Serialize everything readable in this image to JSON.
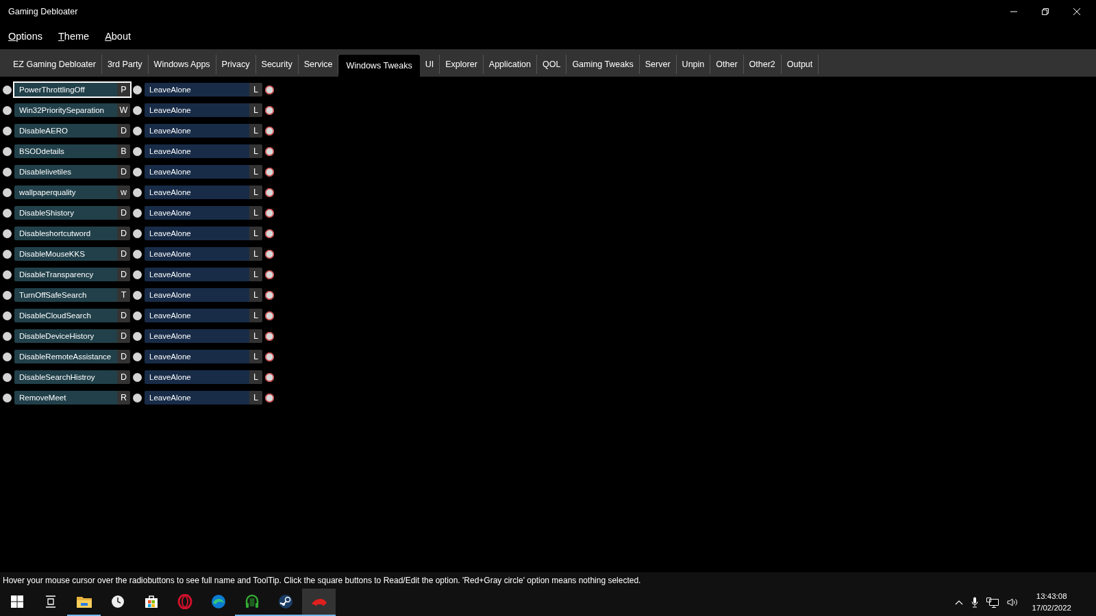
{
  "window": {
    "title": "Gaming Debloater"
  },
  "menu": [
    "Options",
    "Theme",
    "About"
  ],
  "tabs": [
    {
      "label": "EZ Gaming Debloater",
      "selected": false
    },
    {
      "label": "3rd Party",
      "selected": false
    },
    {
      "label": "Windows Apps",
      "selected": false
    },
    {
      "label": "Privacy",
      "selected": false
    },
    {
      "label": "Security",
      "selected": false
    },
    {
      "label": "Service",
      "selected": false
    },
    {
      "label": "Windows Tweaks",
      "selected": true
    },
    {
      "label": "UI",
      "selected": false
    },
    {
      "label": "Explorer",
      "selected": false
    },
    {
      "label": "Application",
      "selected": false
    },
    {
      "label": "QOL",
      "selected": false
    },
    {
      "label": "Gaming Tweaks",
      "selected": false
    },
    {
      "label": "Server",
      "selected": false
    },
    {
      "label": "Unpin",
      "selected": false
    },
    {
      "label": "Other",
      "selected": false
    },
    {
      "label": "Other2",
      "selected": false
    },
    {
      "label": "Output",
      "selected": false
    }
  ],
  "rows": [
    {
      "name": "PowerThrottlingOff",
      "key": "P",
      "value": "LeaveAlone",
      "value_key": "L",
      "focused": true,
      "radios": [
        {
          "selected": false
        },
        {
          "selected": false
        },
        {
          "selected": false
        }
      ]
    },
    {
      "name": "Win32PrioritySeparation",
      "key": "W",
      "value": "LeaveAlone",
      "value_key": "L",
      "focused": false,
      "radios": [
        {
          "selected": false
        },
        {
          "selected": false
        },
        {
          "selected": false
        }
      ]
    },
    {
      "name": "DisableAERO",
      "key": "D",
      "value": "LeaveAlone",
      "value_key": "L",
      "focused": false,
      "radios": [
        {
          "selected": false
        },
        {
          "selected": false
        },
        {
          "selected": false
        }
      ]
    },
    {
      "name": "BSODdetails",
      "key": "B",
      "value": "LeaveAlone",
      "value_key": "L",
      "focused": false,
      "radios": [
        {
          "selected": false
        },
        {
          "selected": false
        },
        {
          "selected": false
        }
      ]
    },
    {
      "name": "Disablelivetiles",
      "key": "D",
      "value": "LeaveAlone",
      "value_key": "L",
      "focused": false,
      "radios": [
        {
          "selected": false
        },
        {
          "selected": false
        },
        {
          "selected": false
        }
      ]
    },
    {
      "name": "wallpaperquality",
      "key": "w",
      "value": "LeaveAlone",
      "value_key": "L",
      "focused": false,
      "radios": [
        {
          "selected": false
        },
        {
          "selected": false
        },
        {
          "selected": false
        }
      ]
    },
    {
      "name": "DisableShistory",
      "key": "D",
      "value": "LeaveAlone",
      "value_key": "L",
      "focused": false,
      "radios": [
        {
          "selected": false
        },
        {
          "selected": false
        },
        {
          "selected": false
        }
      ]
    },
    {
      "name": "Disableshortcutword",
      "key": "D",
      "value": "LeaveAlone",
      "value_key": "L",
      "focused": false,
      "radios": [
        {
          "selected": false
        },
        {
          "selected": false
        },
        {
          "selected": false
        }
      ]
    },
    {
      "name": "DisableMouseKKS",
      "key": "D",
      "value": "LeaveAlone",
      "value_key": "L",
      "focused": false,
      "radios": [
        {
          "selected": false
        },
        {
          "selected": false
        },
        {
          "selected": false
        }
      ]
    },
    {
      "name": "DisableTransparency",
      "key": "D",
      "value": "LeaveAlone",
      "value_key": "L",
      "focused": false,
      "radios": [
        {
          "selected": false
        },
        {
          "selected": false
        },
        {
          "selected": false
        }
      ]
    },
    {
      "name": "TurnOffSafeSearch",
      "key": "T",
      "value": "LeaveAlone",
      "value_key": "L",
      "focused": false,
      "radios": [
        {
          "selected": false
        },
        {
          "selected": false
        },
        {
          "selected": false
        }
      ]
    },
    {
      "name": "DisableCloudSearch",
      "key": "D",
      "value": "LeaveAlone",
      "value_key": "L",
      "focused": false,
      "radios": [
        {
          "selected": false
        },
        {
          "selected": false
        },
        {
          "selected": false
        }
      ]
    },
    {
      "name": "DisableDeviceHistory",
      "key": "D",
      "value": "LeaveAlone",
      "value_key": "L",
      "focused": false,
      "radios": [
        {
          "selected": false
        },
        {
          "selected": false
        },
        {
          "selected": false
        }
      ]
    },
    {
      "name": "DisableRemoteAssistance",
      "key": "D",
      "value": "LeaveAlone",
      "value_key": "L",
      "focused": false,
      "radios": [
        {
          "selected": false
        },
        {
          "selected": false
        },
        {
          "selected": false
        }
      ]
    },
    {
      "name": "DisableSearchHistroy",
      "key": "D",
      "value": "LeaveAlone",
      "value_key": "L",
      "focused": false,
      "radios": [
        {
          "selected": false
        },
        {
          "selected": false
        },
        {
          "selected": false
        }
      ]
    },
    {
      "name": "RemoveMeet",
      "key": "R",
      "value": "LeaveAlone",
      "value_key": "L",
      "focused": false,
      "radios": [
        {
          "selected": false
        },
        {
          "selected": false
        },
        {
          "selected": false
        }
      ]
    }
  ],
  "status_bar": "Hover your mouse cursor over the radiobuttons to see full name and ToolTip. Click the square buttons to Read/Edit the option. 'Red+Gray circle' option means nothing selected.",
  "taskbar": {
    "apps": [
      {
        "kind": "start",
        "running": false,
        "focused": false
      },
      {
        "kind": "taskview",
        "running": false,
        "focused": false
      },
      {
        "kind": "folder",
        "running": true,
        "focused": false
      },
      {
        "kind": "clock",
        "running": false,
        "focused": false
      },
      {
        "kind": "store",
        "running": false,
        "focused": false
      },
      {
        "kind": "ring",
        "running": false,
        "focused": false
      },
      {
        "kind": "wave",
        "running": false,
        "focused": false
      },
      {
        "kind": "headphones",
        "running": true,
        "focused": false
      },
      {
        "kind": "steam",
        "running": true,
        "focused": false
      },
      {
        "kind": "redapp",
        "running": true,
        "focused": true
      }
    ],
    "time": "13:43:08",
    "date": "17/02/2022"
  }
}
